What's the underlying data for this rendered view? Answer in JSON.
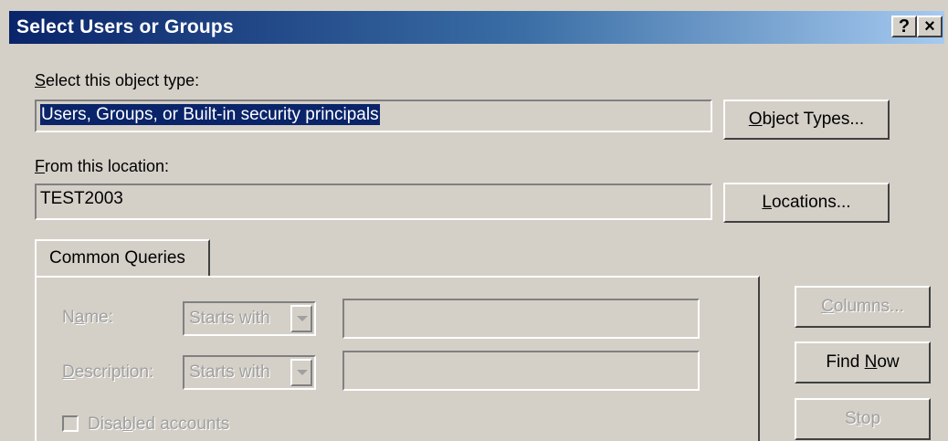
{
  "window": {
    "title": "Select Users or Groups",
    "help_button": "?",
    "close_button": "×"
  },
  "object_type": {
    "label_accel": "S",
    "label_rest": "elect this object type:",
    "value": "Users, Groups, or Built-in security principals",
    "button_accel": "O",
    "button_rest": "bject Types..."
  },
  "location": {
    "label_accel": "F",
    "label_rest": "rom this location:",
    "value": "TEST2003",
    "button_accel": "L",
    "button_rest": "ocations..."
  },
  "tabs": [
    {
      "label": "Common Queries"
    }
  ],
  "queries": {
    "name_label_pre": "N",
    "name_label_accel": "a",
    "name_label_post": "me:",
    "name_match": "Starts with",
    "description_label_accel": "D",
    "description_label_rest": "escription:",
    "description_match": "Starts with",
    "disabled_pre": "Disa",
    "disabled_accel": "b",
    "disabled_post": "led accounts"
  },
  "side_buttons": {
    "columns_accel": "C",
    "columns_rest": "olumns...",
    "find_pre": "Find ",
    "find_accel": "N",
    "find_post": "ow",
    "stop_pre": "S",
    "stop_accel": "t",
    "stop_post": "op"
  },
  "colors": {
    "face": "#d4d0c8",
    "title_start": "#0a246a",
    "title_end": "#a6caf0",
    "selection": "#0a246a",
    "disabled_text": "#a0a0a0"
  }
}
